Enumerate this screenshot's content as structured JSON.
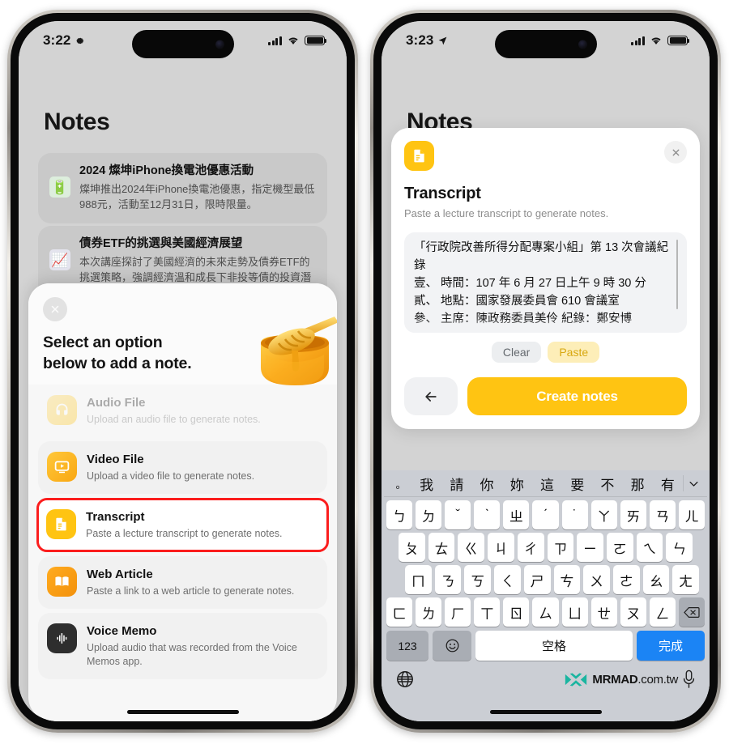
{
  "left_phone": {
    "status_bar": {
      "time": "3:22",
      "icons": [
        "gear-icon",
        "cellular-signal-icon",
        "wifi-icon",
        "battery-icon"
      ]
    },
    "page_title": "Notes",
    "notes": [
      {
        "icon": "green-battery-emoji",
        "title": "2024 燦坤iPhone換電池優惠活動",
        "desc": "燦坤推出2024年iPhone換電池優惠，指定機型最低988元，活動至12月31日，限時限量。"
      },
      {
        "icon": "chart-increasing-emoji",
        "title": "債券ETF的挑選與美國經濟展望",
        "desc": "本次講座探討了美國經濟的未來走勢及債券ETF的挑選策略，強調經濟溫和成長下非投等債的投資潛力。"
      }
    ],
    "sheet": {
      "close_icon": "close-icon",
      "hero_title_line1": "Select an option",
      "hero_title_line2": "below to add a note.",
      "hero_image": "honey-pot-illustration",
      "options": [
        {
          "icon": "headphones-icon",
          "title": "Audio File",
          "desc": "Upload an audio file to generate notes.",
          "state": "disabled"
        },
        {
          "icon": "video-icon",
          "title": "Video File",
          "desc": "Upload a video file to generate notes.",
          "state": "enabled"
        },
        {
          "icon": "document-icon",
          "title": "Transcript",
          "desc": "Paste a lecture transcript to generate notes.",
          "state": "highlighted"
        },
        {
          "icon": "book-icon",
          "title": "Web Article",
          "desc": "Paste a link to a web article to generate notes.",
          "state": "enabled"
        },
        {
          "icon": "waveform-icon",
          "title": "Voice Memo",
          "desc": "Upload audio that was recorded from the Voice Memos app.",
          "state": "enabled"
        }
      ]
    }
  },
  "right_phone": {
    "status_bar": {
      "time": "3:23",
      "icons": [
        "location-arrow-icon",
        "cellular-signal-icon",
        "wifi-icon",
        "battery-icon"
      ]
    },
    "page_title": "Notes",
    "dialog": {
      "icon": "document-icon",
      "close_icon": "close-icon",
      "title": "Transcript",
      "subtitle": "Paste a lecture transcript to generate notes.",
      "textarea_value": "「行政院改善所得分配專案小組」第 13 次會議紀錄\n壹、 時間：107 年 6 月 27 日上午 9 時 30 分\n貳、 地點：國家發展委員會 610 會議室\n參、 主席：陳政務委員美伶 紀錄：鄭安博",
      "clear_label": "Clear",
      "paste_label": "Paste",
      "back_icon": "arrow-left-icon",
      "create_label": "Create notes"
    },
    "keyboard": {
      "predictions": [
        "。",
        "我",
        "請",
        "你",
        "妳",
        "這",
        "要",
        "不",
        "那",
        "有"
      ],
      "collapse_icon": "chevron-down-icon",
      "row1": [
        "ㄅ",
        "ㄉ",
        "ˇ",
        "ˋ",
        "ㄓ",
        "ˊ",
        "˙",
        "ㄚ",
        "ㄞ",
        "ㄢ",
        "ㄦ"
      ],
      "row2": [
        "ㄆ",
        "ㄊ",
        "ㄍ",
        "ㄐ",
        "ㄔ",
        "ㄗ",
        "ㄧ",
        "ㄛ",
        "ㄟ",
        "ㄣ"
      ],
      "row3": [
        "ㄇ",
        "ㄋ",
        "ㄎ",
        "ㄑ",
        "ㄕ",
        "ㄘ",
        "ㄨ",
        "ㄜ",
        "ㄠ",
        "ㄤ"
      ],
      "row4": [
        "ㄈ",
        "ㄌ",
        "ㄏ",
        "ㄒ",
        "ㄖ",
        "ㄙ",
        "ㄩ",
        "ㄝ",
        "ㄡ",
        "ㄥ"
      ],
      "backspace_icon": "backspace-icon",
      "numbers_label": "123",
      "emoji_icon": "emoji-icon",
      "space_label": "空格",
      "done_label": "完成",
      "globe_icon": "globe-icon",
      "mic_icon": "microphone-icon"
    },
    "watermark": {
      "logo": "mrmad-logo-icon",
      "text_bold": "MRMAD",
      "text_light": ".com.tw"
    }
  },
  "colors": {
    "accent_yellow": "#ffc412",
    "highlight_red": "#fb1d1d",
    "keyboard_blue": "#1b84f5",
    "orange": "#f59b1a"
  }
}
